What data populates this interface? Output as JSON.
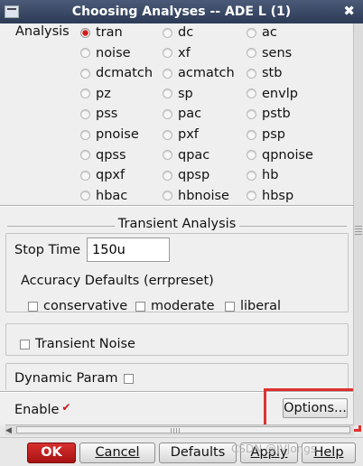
{
  "window": {
    "title": "Choosing Analyses -- ADE L (1)",
    "close_glyph": "✖"
  },
  "analysis": {
    "label": "Analysis",
    "selected": "tran",
    "options": [
      "tran",
      "dc",
      "ac",
      "noise",
      "xf",
      "sens",
      "dcmatch",
      "acmatch",
      "stb",
      "pz",
      "sp",
      "envlp",
      "pss",
      "pac",
      "pstb",
      "pnoise",
      "pxf",
      "psp",
      "qpss",
      "qpac",
      "qpnoise",
      "qpxf",
      "qpsp",
      "hb",
      "hbac",
      "hbnoise",
      "hbsp"
    ]
  },
  "transient": {
    "title": "Transient Analysis",
    "stop_time_label": "Stop Time",
    "stop_time_value": "150u",
    "accuracy_label": "Accuracy Defaults (errpreset)",
    "accuracy_options": [
      {
        "label": "conservative",
        "checked": false
      },
      {
        "label": "moderate",
        "checked": false
      },
      {
        "label": "liberal",
        "checked": false
      }
    ],
    "noise_label": "Transient Noise",
    "dynamic_label": "Dynamic Param",
    "enable_label": "Enable",
    "enable_checked": true,
    "options_button": "Options..."
  },
  "footer": {
    "ok": "OK",
    "cancel": "Cancel",
    "defaults": "Defaults",
    "apply": "Apply",
    "help": "Help",
    "watermark": "CSDN @JVJongs"
  },
  "colors": {
    "accent": "#c41414",
    "titlebar": "#34425f",
    "highlight": "#e03030"
  }
}
